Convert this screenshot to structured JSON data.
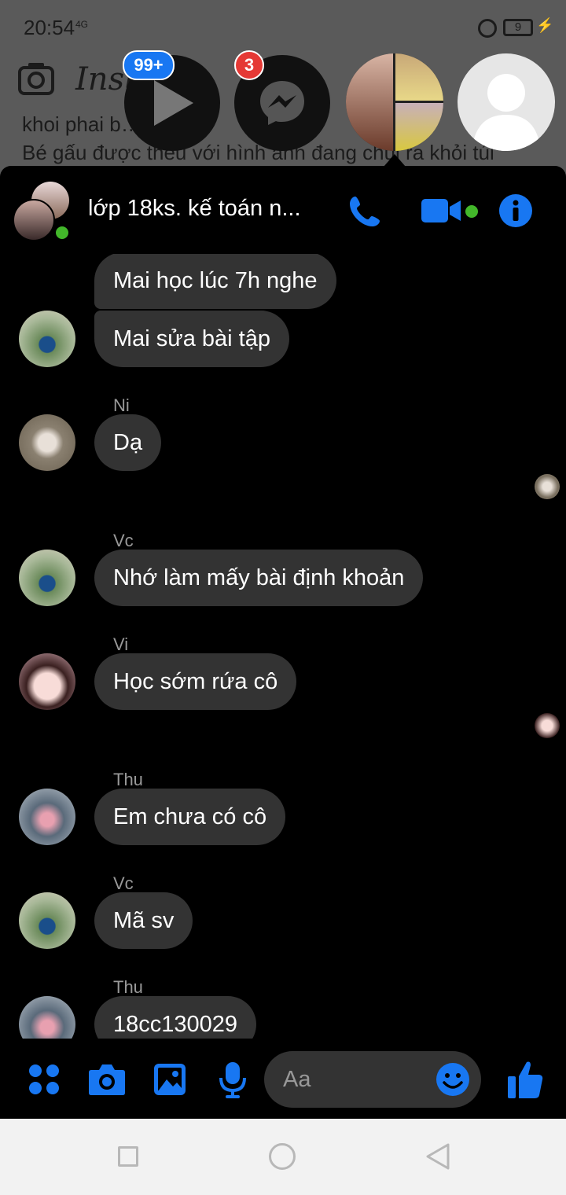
{
  "status_bar": {
    "time": "20:54",
    "network": "4G",
    "battery": "9"
  },
  "background_app": {
    "name": "Insta",
    "post_lines": [
      "khoi phai b…",
      "Bé gấu được thêu với hình ảnh đang chui ra khỏi túi"
    ]
  },
  "chat_heads": {
    "video_badge": "99+",
    "messenger_badge": "3"
  },
  "conversation": {
    "title": "lớp 18ks. kế toán n...",
    "icons": [
      "phone-icon",
      "video-icon",
      "info-icon"
    ]
  },
  "messages": [
    {
      "text": "Mai học lúc 7h nghe"
    },
    {
      "text": "Mai sửa bài tập"
    },
    {
      "sender": "Ni",
      "text": "Dạ"
    },
    {
      "sender": "Vc",
      "text": "Nhớ làm mấy bài định khoản"
    },
    {
      "sender": "Vi",
      "text": "Học sớm rứa cô"
    },
    {
      "sender": "Thu",
      "text": "Em chưa có cô"
    },
    {
      "sender": "Vc",
      "text": "Mã sv"
    },
    {
      "sender": "Thu",
      "text": "18cc130029"
    }
  ],
  "composer": {
    "placeholder": "Aa"
  },
  "colors": {
    "accent": "#1877f2",
    "bubble": "#333333",
    "online": "#42b72a",
    "badge_red": "#e53935"
  }
}
